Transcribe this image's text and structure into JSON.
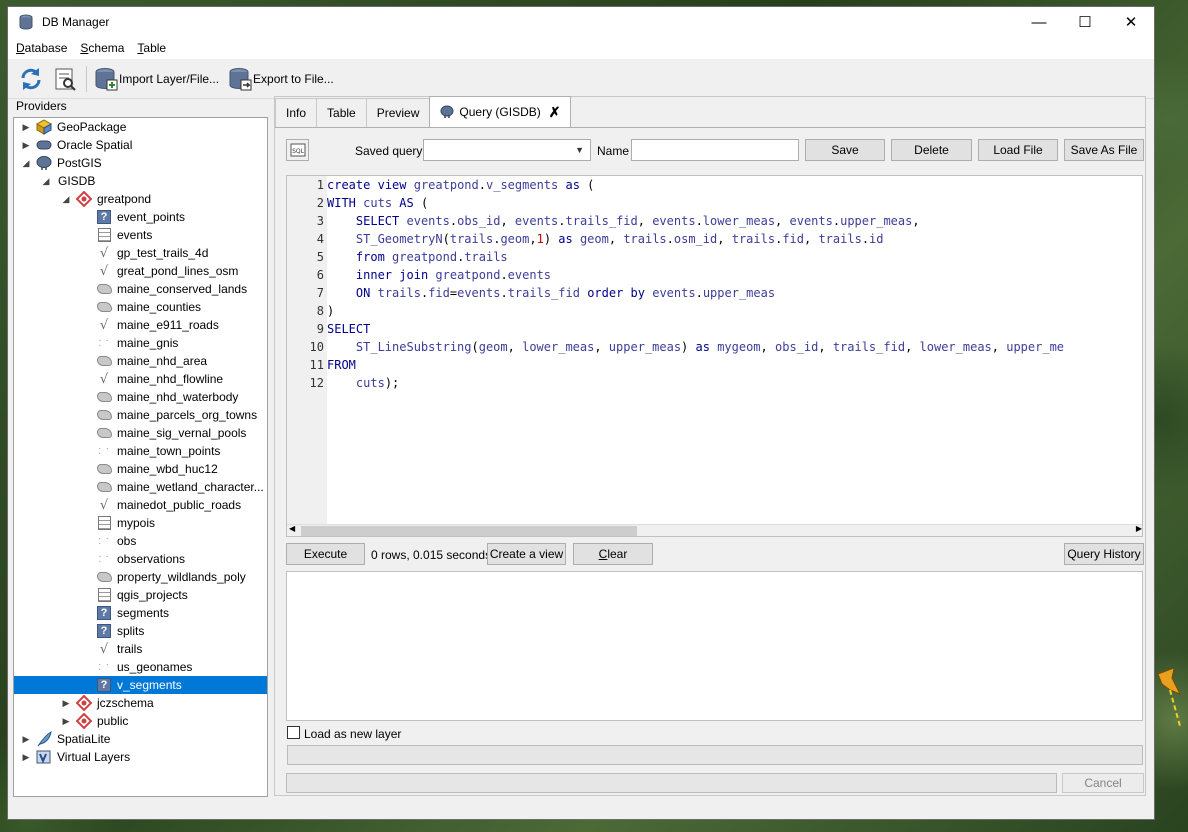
{
  "window": {
    "title": "DB Manager",
    "controls": [
      "minimize",
      "maximize",
      "close"
    ]
  },
  "menu": [
    {
      "label": "Database",
      "accel": "D",
      "rest": "atabase"
    },
    {
      "label": "Schema",
      "accel": "S",
      "rest": "chema"
    },
    {
      "label": "Table",
      "accel": "T",
      "rest": "able"
    }
  ],
  "toolbar": {
    "import_label": "Import Layer/File...",
    "export_label": "Export to File..."
  },
  "providers": {
    "label": "Providers",
    "tree": [
      {
        "label": "GeoPackage",
        "icon": "geopackage-icon",
        "level": 0,
        "expanded": false
      },
      {
        "label": "Oracle Spatial",
        "icon": "oracle-icon",
        "level": 0,
        "expanded": false
      },
      {
        "label": "PostGIS",
        "icon": "postgis-elephant-icon",
        "level": 0,
        "expanded": true
      },
      {
        "label": "GISDB",
        "icon": "none",
        "level": 1,
        "expanded": true
      },
      {
        "label": "greatpond",
        "icon": "schema-icon",
        "level": 2,
        "expanded": true
      },
      {
        "label": "event_points",
        "icon": "unknown-geometry-icon",
        "level": 3
      },
      {
        "label": "events",
        "icon": "table-icon",
        "level": 3
      },
      {
        "label": "gp_test_trails_4d",
        "icon": "line-layer-icon",
        "level": 3
      },
      {
        "label": "great_pond_lines_osm",
        "icon": "line-layer-icon",
        "level": 3
      },
      {
        "label": "maine_conserved_lands",
        "icon": "polygon-layer-icon",
        "level": 3
      },
      {
        "label": "maine_counties",
        "icon": "polygon-layer-icon",
        "level": 3
      },
      {
        "label": "maine_e911_roads",
        "icon": "line-layer-icon",
        "level": 3
      },
      {
        "label": "maine_gnis",
        "icon": "point-layer-icon",
        "level": 3
      },
      {
        "label": "maine_nhd_area",
        "icon": "polygon-layer-icon",
        "level": 3
      },
      {
        "label": "maine_nhd_flowline",
        "icon": "line-layer-icon",
        "level": 3
      },
      {
        "label": "maine_nhd_waterbody",
        "icon": "polygon-layer-icon",
        "level": 3
      },
      {
        "label": "maine_parcels_org_towns",
        "icon": "polygon-layer-icon",
        "level": 3
      },
      {
        "label": "maine_sig_vernal_pools",
        "icon": "polygon-layer-icon",
        "level": 3
      },
      {
        "label": "maine_town_points",
        "icon": "point-layer-icon",
        "level": 3
      },
      {
        "label": "maine_wbd_huc12",
        "icon": "polygon-layer-icon",
        "level": 3
      },
      {
        "label": "maine_wetland_character...",
        "icon": "polygon-layer-icon",
        "level": 3
      },
      {
        "label": "mainedot_public_roads",
        "icon": "line-layer-icon",
        "level": 3
      },
      {
        "label": "mypois",
        "icon": "table-icon",
        "level": 3
      },
      {
        "label": "obs",
        "icon": "point-layer-icon",
        "level": 3
      },
      {
        "label": "observations",
        "icon": "point-layer-icon",
        "level": 3
      },
      {
        "label": "property_wildlands_poly",
        "icon": "polygon-layer-icon",
        "level": 3
      },
      {
        "label": "qgis_projects",
        "icon": "table-icon",
        "level": 3
      },
      {
        "label": "segments",
        "icon": "unknown-geometry-icon",
        "level": 3
      },
      {
        "label": "splits",
        "icon": "unknown-geometry-icon",
        "level": 3
      },
      {
        "label": "trails",
        "icon": "line-layer-icon",
        "level": 3
      },
      {
        "label": "us_geonames",
        "icon": "point-layer-icon",
        "level": 3
      },
      {
        "label": "v_segments",
        "icon": "unknown-geometry-icon",
        "level": 3,
        "selected": true
      },
      {
        "label": "jczschema",
        "icon": "schema-icon",
        "level": 2,
        "expanded": false
      },
      {
        "label": "public",
        "icon": "schema-icon",
        "level": 2,
        "expanded": false
      },
      {
        "label": "SpatiaLite",
        "icon": "spatialite-feather-icon",
        "level": 0,
        "expanded": false
      },
      {
        "label": "Virtual Layers",
        "icon": "virtual-layers-icon",
        "level": 0,
        "expanded": false
      }
    ]
  },
  "tabs": [
    {
      "label": "Info"
    },
    {
      "label": "Table"
    },
    {
      "label": "Preview"
    },
    {
      "label": "Query (GISDB)",
      "active": true
    }
  ],
  "query": {
    "saved_query_label": "Saved query",
    "saved_query_value": "",
    "name_label": "Name",
    "name_value": "",
    "save_label": "Save",
    "delete_label": "Delete",
    "load_file_label": "Load File",
    "save_as_file_label": "Save As File",
    "sql_lines": [
      "create view greatpond.v_segments as (",
      "WITH cuts AS (",
      "    SELECT events.obs_id, events.trails_fid, events.lower_meas, events.upper_meas,",
      "    ST_GeometryN(trails.geom,1) as geom, trails.osm_id, trails.fid, trails.id",
      "    from greatpond.trails",
      "    inner join greatpond.events",
      "    ON trails.fid=events.trails_fid order by events.upper_meas",
      ")",
      "SELECT",
      "    ST_LineSubstring(geom, lower_meas, upper_meas) as mygeom, obs_id, trails_fid, lower_meas, upper_me",
      "FROM",
      "    cuts);"
    ],
    "execute_label": "Execute",
    "status_text": "0 rows, 0.015 seconds",
    "create_view_label": "Create a view",
    "clear_label": "Clear",
    "clear_accel": "C",
    "clear_rest": "lear",
    "query_history_label": "Query History",
    "load_as_layer_label": "Load as new layer",
    "load_as_layer_checked": false,
    "cancel_label": "Cancel"
  }
}
